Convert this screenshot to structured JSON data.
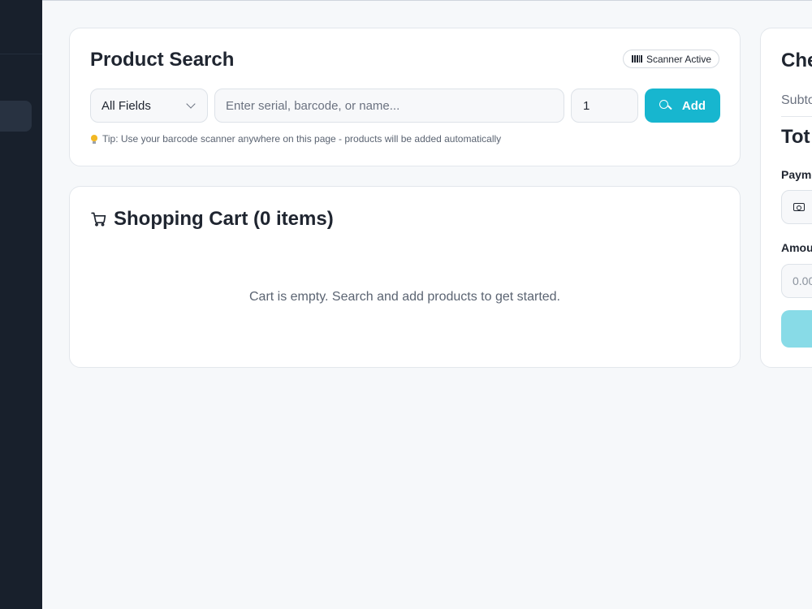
{
  "product_search": {
    "title": "Product Search",
    "scanner_badge": "Scanner Active",
    "field_select": {
      "selected": "All Fields"
    },
    "search_input": {
      "value": "",
      "placeholder": "Enter serial, barcode, or name..."
    },
    "quantity": "1",
    "add_label": "Add",
    "tip": "Tip: Use your barcode scanner anywhere on this page - products will be added automatically"
  },
  "cart": {
    "title": "Shopping Cart (0 items)",
    "empty_message": "Cart is empty. Search and add products to get started."
  },
  "checkout": {
    "title": "Che",
    "subtotal_label": "Subto",
    "total_label": "Tot",
    "payment_label": "Payme",
    "amount_label": "Amou",
    "amount_placeholder": "0.00"
  },
  "icons": [
    "barcode-icon",
    "chevron-down-icon",
    "search-icon",
    "lightbulb-icon",
    "cart-icon",
    "cash-icon"
  ],
  "colors": {
    "accent": "#17b6cf",
    "accent_disabled": "#88dbe7",
    "sidebar": "#18202c",
    "background": "#f6f8fa"
  }
}
